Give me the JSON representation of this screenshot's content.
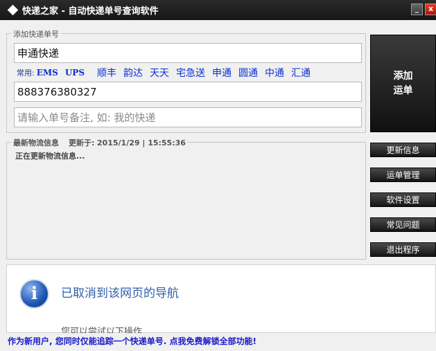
{
  "window": {
    "title": "快递之家 - 自动快递单号查询软件",
    "minimize_label": "_",
    "close_label": "x"
  },
  "add_section": {
    "legend": "添加快递单号",
    "company_value": "申通快递",
    "common_label": "常用:",
    "carriers": [
      "EMS",
      "UPS",
      "顺丰",
      "韵达",
      "天天",
      "宅急送",
      "申通",
      "圆通",
      "中通",
      "汇通"
    ],
    "number_value": "888376380327",
    "note_placeholder": "请输入单号备注, 如: 我的快递",
    "add_button_line1": "添加",
    "add_button_line2": "运单"
  },
  "info_section": {
    "legend_title": "最新物流信息",
    "updated_label": "更新于:",
    "updated_value": "2015/1/29 | 15:55:36",
    "status": "正在更新物流信息..."
  },
  "side_buttons": {
    "refresh": "更新信息",
    "manage": "运单管理",
    "settings": "软件设置",
    "faq": "常见问题",
    "exit": "退出程序"
  },
  "web_panel": {
    "icon": "info-icon",
    "title": "已取消到该网页的导航",
    "subtitle": "您可以尝试以下操作"
  },
  "footer": {
    "text": "作为新用户, 您同时仅能追踪一个快递单号. 点我免费解锁全部功能!"
  }
}
